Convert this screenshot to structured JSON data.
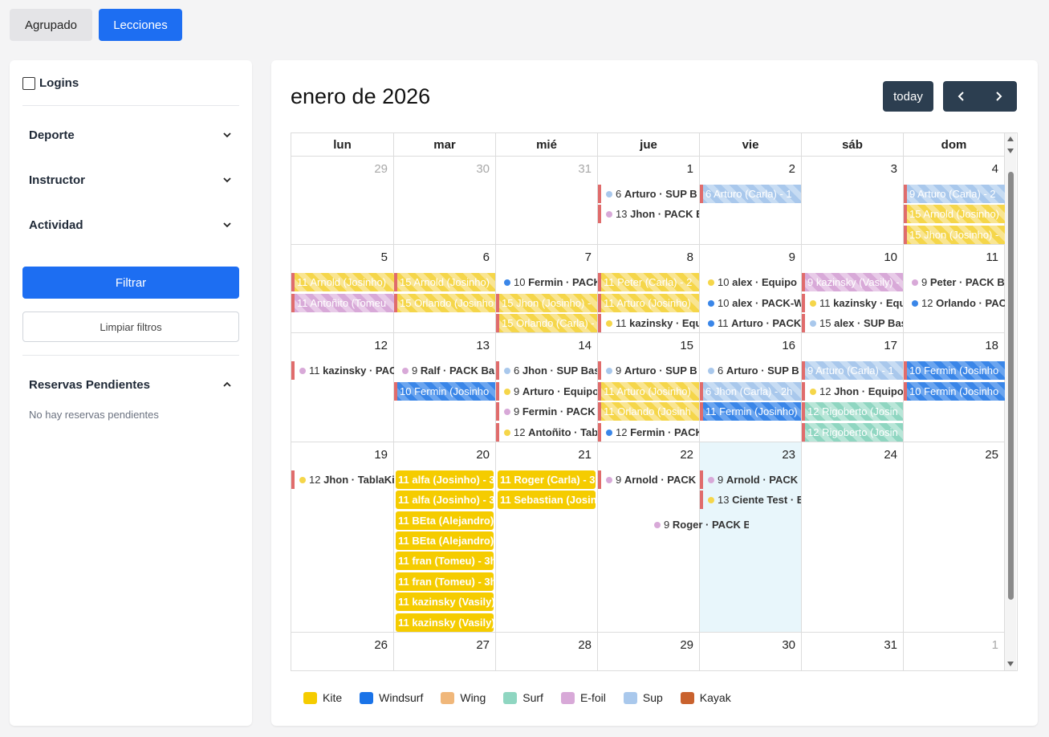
{
  "top_tabs": {
    "agrupado": "Agrupado",
    "lecciones": "Lecciones"
  },
  "sidebar": {
    "logins": "Logins",
    "filters": [
      "Deporte",
      "Instructor",
      "Actividad"
    ],
    "filtrar": "Filtrar",
    "limpiar": "Limpiar filtros",
    "pending_title": "Reservas Pendientes",
    "pending_empty": "No hay reservas pendientes"
  },
  "calendar": {
    "title": "enero de 2026",
    "today_label": "today",
    "weekdays": [
      "lun",
      "mar",
      "mié",
      "jue",
      "vie",
      "sáb",
      "dom"
    ],
    "weeks": [
      [
        "29",
        "30",
        "31",
        "1",
        "2",
        "3",
        "4"
      ],
      [
        "5",
        "6",
        "7",
        "8",
        "9",
        "10",
        "11"
      ],
      [
        "12",
        "13",
        "14",
        "15",
        "16",
        "17",
        "18"
      ],
      [
        "19",
        "20",
        "21",
        "22",
        "23",
        "24",
        "25"
      ],
      [
        "26",
        "27",
        "28",
        "29",
        "30",
        "31",
        "1"
      ]
    ],
    "events": {
      "w0": [
        {
          "t": "6",
          "n": "Arturo · SUP B"
        },
        {
          "t": "13",
          "n": "Jhon · PACK E"
        },
        {
          "t": "6 Arturo (Carla) - 1"
        },
        {
          "t": "9 Arturo (Carla) - 2"
        },
        {
          "t": "15 Arnold (Josinho)"
        },
        {
          "t": "15 Jhon (Josinho) -"
        }
      ],
      "w1": [
        {
          "t": "11 Arnold (Josinho)"
        },
        {
          "t": "11 Antoñito (Tomeu"
        },
        {
          "t": "15 Arnold (Josinho)"
        },
        {
          "t": "15 Orlando (Josinho"
        },
        {
          "t": "10",
          "n": "Fermin · PACK"
        },
        {
          "t": "15 Jhon (Josinho) -"
        },
        {
          "t": "15 Orlando (Carla) -"
        },
        {
          "t": "11 Peter (Carla) - 2"
        },
        {
          "t": "11 Arturo (Josinho)"
        },
        {
          "t": "11",
          "n": "kazinsky · Equ"
        },
        {
          "t": "10",
          "n": "alex · Equipo"
        },
        {
          "t": "10",
          "n": "alex · PACK-W"
        },
        {
          "t": "11",
          "n": "Arturo · PACK"
        },
        {
          "t": "9 kazinsky (Vasily) -"
        },
        {
          "t": "11",
          "n": "kazinsky · Equ"
        },
        {
          "t": "15",
          "n": "alex · SUP Bas"
        },
        {
          "t": "9",
          "n": "Peter · PACK B"
        },
        {
          "t": "12",
          "n": "Orlando · PAC"
        }
      ],
      "w2": [
        {
          "t": "11",
          "n": "kazinsky · PAC"
        },
        {
          "t": "9",
          "n": "Ralf · PACK Ba"
        },
        {
          "t": "10 Fermin (Josinho"
        },
        {
          "t": "6",
          "n": "Jhon · SUP Bas"
        },
        {
          "t": "9",
          "n": "Arturo · Equipo"
        },
        {
          "t": "9",
          "n": "Fermin · PACK"
        },
        {
          "t": "12",
          "n": "Antoñito · Tab"
        },
        {
          "t": "9",
          "n": "Arturo · SUP B"
        },
        {
          "t": "11 Arturo (Josinho)"
        },
        {
          "t": "11 Orlando (Josinh"
        },
        {
          "t": "12",
          "n": "Fermin · PACK"
        },
        {
          "t": "6",
          "n": "Arturo · SUP B"
        },
        {
          "t": "6 Jhon (Carla) - 2h"
        },
        {
          "t": "11 Fermin (Josinho)"
        },
        {
          "t": "9 Arturo (Carla) - 1"
        },
        {
          "t": "12",
          "n": "Jhon · Equipo"
        },
        {
          "t": "12 Rigoberto (Josin"
        },
        {
          "t": "12 Rigoberto (Josin"
        },
        {
          "t": "10 Fermin (Josinho"
        },
        {
          "t": "10 Fermin (Josinho"
        }
      ],
      "w3": [
        {
          "t": "12",
          "n": "Jhon · TablaKi"
        },
        {
          "t": "11 alfa (Josinho) - 3l"
        },
        {
          "t": "11 alfa (Josinho) - 3l"
        },
        {
          "t": "11 BEta (Alejandro) -"
        },
        {
          "t": "11 BEta (Alejandro) -"
        },
        {
          "t": "11 fran (Tomeu) - 3h"
        },
        {
          "t": "11 fran (Tomeu) - 3h"
        },
        {
          "t": "11 kazinsky (Vasily) -"
        },
        {
          "t": "11 kazinsky (Vasily) -"
        },
        {
          "t": "11 Roger (Carla) - 3l"
        },
        {
          "t": "11 Sebastian (Josinh"
        },
        {
          "t": "9",
          "n": "Arnold · PACK"
        },
        {
          "t": "9",
          "n": "Roger · PACK Ba"
        },
        {
          "t": "9",
          "n": "Arnold · PACK"
        },
        {
          "t": "13",
          "n": "Ciente Test · E"
        }
      ]
    }
  },
  "legend": [
    {
      "label": "Kite",
      "color": "#f5cc00"
    },
    {
      "label": "Windsurf",
      "color": "#1a73e8"
    },
    {
      "label": "Wing",
      "color": "#f0b77a"
    },
    {
      "label": "Surf",
      "color": "#8fd6c1"
    },
    {
      "label": "E-foil",
      "color": "#d8a9d8"
    },
    {
      "label": "Sup",
      "color": "#a9c8ec"
    },
    {
      "label": "Kayak",
      "color": "#c9622e"
    }
  ]
}
